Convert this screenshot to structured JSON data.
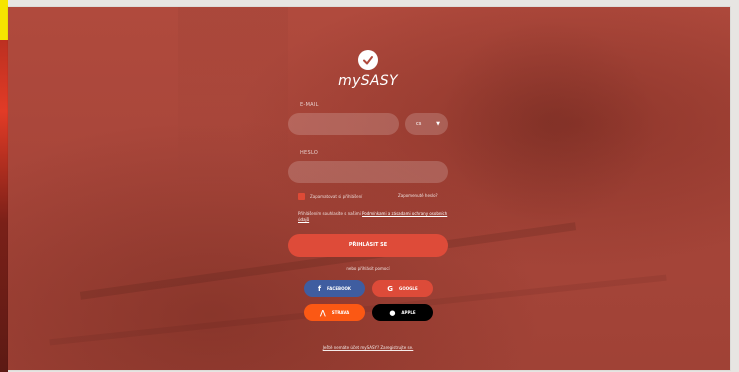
{
  "brand": {
    "name": "mySASY"
  },
  "form": {
    "email_label": "E-MAIL",
    "email_value": "",
    "email_placeholder": "",
    "language_value": "cs",
    "password_label": "HESLO",
    "password_value": "",
    "remember_label": "Zapamatovat si přihlášení",
    "forgot_label": "Zapomenuté heslo?",
    "consent_text": "Přihlášením souhlasíte s našimi",
    "consent_link": "Podmínkami a zásadami ochrany osobních údajů",
    "login_label": "PŘIHLÁSIT SE",
    "or_text": "nebo přihlásit pomocí"
  },
  "social": {
    "facebook": "FACEBOOK",
    "google": "GOOGLE",
    "strava": "STRAVA",
    "apple": "APPLE"
  },
  "footer": {
    "register_text": "Ještě nemáte účet mySASY? Zaregistrujte se."
  },
  "colors": {
    "accent": "#de4b39",
    "facebook": "#3f5da0",
    "google": "#dd4b39",
    "strava": "#fb5814",
    "apple": "#000000",
    "overlay": "#a8463a"
  }
}
